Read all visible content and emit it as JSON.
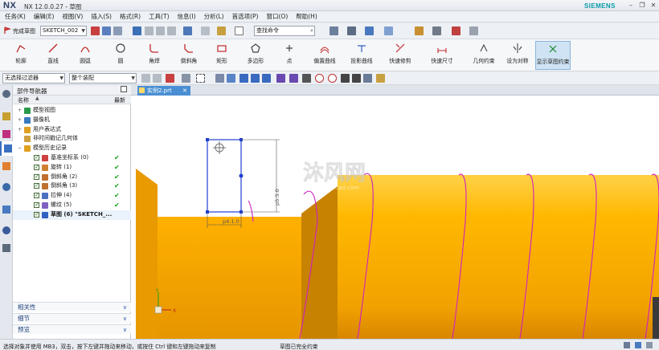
{
  "app": {
    "logo": "NX",
    "title": "NX 12.0.0.27 - 草图",
    "brand": "SIEMENS"
  },
  "window_controls": [
    "–",
    "❐",
    "✕"
  ],
  "menu": [
    "任务(K)",
    "编辑(E)",
    "视图(V)",
    "插入(S)",
    "格式(R)",
    "工具(T)",
    "信息(I)",
    "分析(L)",
    "首选项(P)",
    "窗口(O)",
    "帮助(H)"
  ],
  "toolbar": {
    "finish_sketch": "完成草图",
    "sketch_name": "SKETCH_002",
    "command_search_placeholder": "查找命令"
  },
  "ribbon": {
    "tools": [
      {
        "label": "轮廓",
        "icon": "profile-icon"
      },
      {
        "label": "直线",
        "icon": "line-icon"
      },
      {
        "label": "圆弧",
        "icon": "arc-icon"
      },
      {
        "label": "圆",
        "icon": "circle-icon"
      },
      {
        "label": "角焊",
        "icon": "fillet-icon"
      },
      {
        "label": "倒斜角",
        "icon": "chamfer-icon"
      },
      {
        "label": "矩形",
        "icon": "rectangle-icon"
      },
      {
        "label": "多边形",
        "icon": "polygon-icon"
      },
      {
        "label": "点",
        "icon": "point-icon"
      },
      {
        "label": "偏置曲线",
        "icon": "offset-curve-icon"
      },
      {
        "label": "投影曲线",
        "icon": "project-curve-icon"
      },
      {
        "label": "快速修剪",
        "icon": "quick-trim-icon"
      },
      {
        "label": "快速尺寸",
        "icon": "rapid-dimension-icon"
      },
      {
        "label": "几何约束",
        "icon": "geometric-constraint-icon"
      },
      {
        "label": "设为对称",
        "icon": "make-symmetric-icon"
      },
      {
        "label": "显示草图约束",
        "icon": "show-constraints-icon"
      }
    ]
  },
  "filterbar": {
    "selection_filter": "无选择过滤器",
    "scope": "整个装配"
  },
  "navigator": {
    "title": "部件导航器",
    "col_name": "名称",
    "col_latest": "最新",
    "items": [
      {
        "label": "模型视图",
        "indent": 0,
        "expand": "+",
        "checkbox": false,
        "latest": ""
      },
      {
        "label": "摄像机",
        "indent": 0,
        "expand": "+",
        "checkbox": false,
        "latest": ""
      },
      {
        "label": "用户表达式",
        "indent": 0,
        "expand": "+",
        "checkbox": false,
        "latest": ""
      },
      {
        "label": "非时间戳记几何体",
        "indent": 0,
        "expand": "",
        "checkbox": false,
        "latest": ""
      },
      {
        "label": "模型历史记录",
        "indent": 0,
        "expand": "−",
        "checkbox": false,
        "latest": ""
      },
      {
        "label": "基准坐标系 (0)",
        "indent": 1,
        "expand": "",
        "checkbox": true,
        "latest": "✔"
      },
      {
        "label": "旋转 (1)",
        "indent": 1,
        "expand": "",
        "checkbox": true,
        "latest": "✔"
      },
      {
        "label": "倒斜角 (2)",
        "indent": 1,
        "expand": "",
        "checkbox": true,
        "latest": "✔"
      },
      {
        "label": "倒斜角 (3)",
        "indent": 1,
        "expand": "",
        "checkbox": true,
        "latest": "✔"
      },
      {
        "label": "拉伸 (4)",
        "indent": 1,
        "expand": "",
        "checkbox": true,
        "latest": "✔"
      },
      {
        "label": "螺纹 (5)",
        "indent": 1,
        "expand": "",
        "checkbox": true,
        "latest": "✔"
      },
      {
        "label": "草图 (6) \"SKETCH_...",
        "indent": 1,
        "expand": "",
        "checkbox": true,
        "latest": "",
        "bold": true
      }
    ],
    "sections": [
      "相关性",
      "细节",
      "预览"
    ]
  },
  "graphics": {
    "tab_label": "实例2.prt",
    "dim_vertical": "p5:5.0",
    "dim_horizontal": "p4:1.0",
    "watermark_name": "沐风网",
    "watermark_url": "www.mfcad.com",
    "colors": {
      "body": "#ffb300",
      "body_dark": "#d98a00",
      "sketch": "#2040d0",
      "thread": "#d020c0"
    }
  },
  "status": {
    "left": "选择对象并使用 MB3，双击，按下左键并拖动来移动，或按住 Ctrl 键和左键拖动来复制",
    "middle": "草图已完全约束"
  }
}
